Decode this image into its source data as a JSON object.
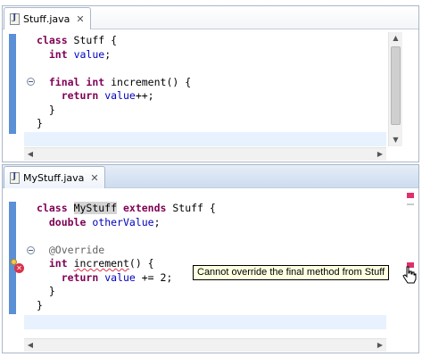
{
  "editors": [
    {
      "tab_label": "Stuff.java",
      "tab_icon": "java-file-icon",
      "close_icon": "close-icon",
      "lines": [
        {
          "parts": [
            {
              "t": "class",
              "c": "kw"
            },
            {
              "t": " Stuff {",
              "c": ""
            }
          ]
        },
        {
          "parts": [
            {
              "t": "  ",
              "c": ""
            },
            {
              "t": "int",
              "c": "kw"
            },
            {
              "t": " ",
              "c": ""
            },
            {
              "t": "value",
              "c": "fld"
            },
            {
              "t": ";",
              "c": ""
            }
          ]
        },
        {
          "parts": [
            {
              "t": "",
              "c": ""
            }
          ]
        },
        {
          "parts": [
            {
              "t": "  ",
              "c": ""
            },
            {
              "t": "final",
              "c": "kw"
            },
            {
              "t": " ",
              "c": ""
            },
            {
              "t": "int",
              "c": "kw"
            },
            {
              "t": " increment() {",
              "c": ""
            }
          ]
        },
        {
          "parts": [
            {
              "t": "    ",
              "c": ""
            },
            {
              "t": "return",
              "c": "kw"
            },
            {
              "t": " ",
              "c": ""
            },
            {
              "t": "value",
              "c": "fld"
            },
            {
              "t": "++;",
              "c": ""
            }
          ]
        },
        {
          "parts": [
            {
              "t": "  }",
              "c": ""
            }
          ]
        },
        {
          "parts": [
            {
              "t": "}",
              "c": ""
            }
          ]
        }
      ]
    },
    {
      "tab_label": "MyStuff.java",
      "tab_icon": "java-file-icon",
      "close_icon": "close-icon",
      "lines": [
        {
          "parts": [
            {
              "t": "class",
              "c": "kw"
            },
            {
              "t": " ",
              "c": ""
            },
            {
              "t": "MyStuff",
              "c": "hl"
            },
            {
              "t": " ",
              "c": ""
            },
            {
              "t": "extends",
              "c": "kw"
            },
            {
              "t": " Stuff {",
              "c": ""
            }
          ]
        },
        {
          "parts": [
            {
              "t": "  ",
              "c": ""
            },
            {
              "t": "double",
              "c": "kw"
            },
            {
              "t": " ",
              "c": ""
            },
            {
              "t": "otherValue",
              "c": "fld"
            },
            {
              "t": ";",
              "c": ""
            }
          ]
        },
        {
          "parts": [
            {
              "t": "",
              "c": ""
            }
          ]
        },
        {
          "parts": [
            {
              "t": "  ",
              "c": ""
            },
            {
              "t": "@Override",
              "c": "ann"
            }
          ]
        },
        {
          "parts": [
            {
              "t": "  ",
              "c": ""
            },
            {
              "t": "int",
              "c": "kw"
            },
            {
              "t": " ",
              "c": ""
            },
            {
              "t": "increment",
              "c": "err"
            },
            {
              "t": "() {",
              "c": ""
            }
          ]
        },
        {
          "parts": [
            {
              "t": "    ",
              "c": ""
            },
            {
              "t": "return",
              "c": "kw"
            },
            {
              "t": " ",
              "c": ""
            },
            {
              "t": "value",
              "c": "fld"
            },
            {
              "t": " += 2;",
              "c": ""
            }
          ]
        },
        {
          "parts": [
            {
              "t": "  }",
              "c": ""
            }
          ]
        },
        {
          "parts": [
            {
              "t": "}",
              "c": ""
            }
          ]
        }
      ],
      "tooltip": "Cannot override the final method from Stuff",
      "error_marker_icon": "error-icon",
      "quickfix_icon": "lightbulb-icon"
    }
  ],
  "colors": {
    "keyword": "#7f0055",
    "field": "#0000c0",
    "annotation": "#646464",
    "error": "#e0304a",
    "change_bar": "#5b8fd6"
  }
}
